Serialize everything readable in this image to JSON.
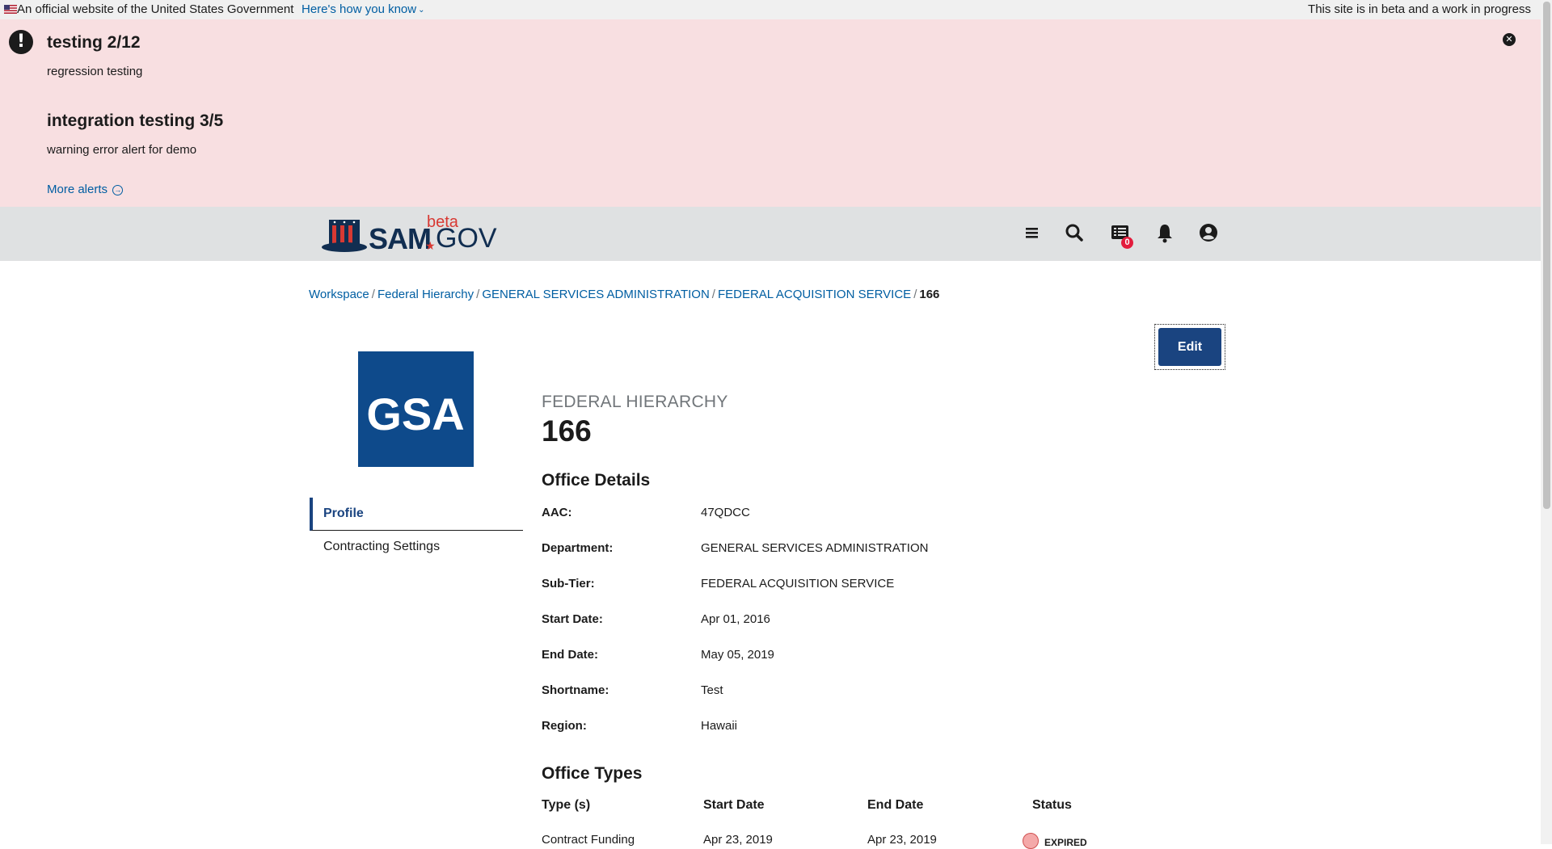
{
  "gov_banner": {
    "official_text": "An official website of the United States Government",
    "how_link": "Here's how you know",
    "beta_text": "This site is in beta and a work in progress"
  },
  "alerts": {
    "items": [
      {
        "title": "testing 2/12",
        "body": "regression testing"
      },
      {
        "title": "integration testing 3/5",
        "body": "warning error alert for demo"
      }
    ],
    "more_link": "More alerts"
  },
  "header": {
    "logo": {
      "word": "SAM",
      "suffix": "GOV",
      "beta": "beta"
    },
    "nav_icons": [
      "menu-icon",
      "search-icon",
      "messages-icon",
      "bell-icon",
      "user-icon"
    ],
    "messages_badge": "0"
  },
  "breadcrumb": {
    "items": [
      "Workspace",
      "Federal Hierarchy",
      "GENERAL SERVICES ADMINISTRATION",
      "FEDERAL ACQUISITION SERVICE"
    ],
    "current": "166"
  },
  "edit_button": "Edit",
  "gsa_logo": {
    "text": "GSA",
    "color": "#0e4a8b"
  },
  "side_nav": {
    "items": [
      "Profile",
      "Contracting Settings"
    ],
    "active": "Profile"
  },
  "page": {
    "kicker": "FEDERAL HIERARCHY",
    "title": "166"
  },
  "office_details": {
    "heading": "Office Details",
    "rows": [
      {
        "label": "AAC:",
        "value": "47QDCC"
      },
      {
        "label": "Department:",
        "value": "GENERAL SERVICES ADMINISTRATION"
      },
      {
        "label": "Sub-Tier:",
        "value": "FEDERAL ACQUISITION SERVICE"
      },
      {
        "label": "Start Date:",
        "value": "Apr 01, 2016"
      },
      {
        "label": "End Date:",
        "value": "May 05, 2019"
      },
      {
        "label": "Shortname:",
        "value": "Test"
      },
      {
        "label": "Region:",
        "value": "Hawaii"
      }
    ]
  },
  "office_types": {
    "heading": "Office Types",
    "columns": [
      "Type (s)",
      "Start Date",
      "End Date",
      "Status"
    ],
    "rows": [
      {
        "type": "Contract Funding",
        "start": "Apr 23, 2019",
        "end": "Apr 23, 2019",
        "status": "EXPIRED"
      }
    ]
  },
  "colors": {
    "alert_bg": "#f8dfe1",
    "header_bg": "#dfe1e2",
    "link": "#005ea2",
    "primary": "#1a4480"
  }
}
